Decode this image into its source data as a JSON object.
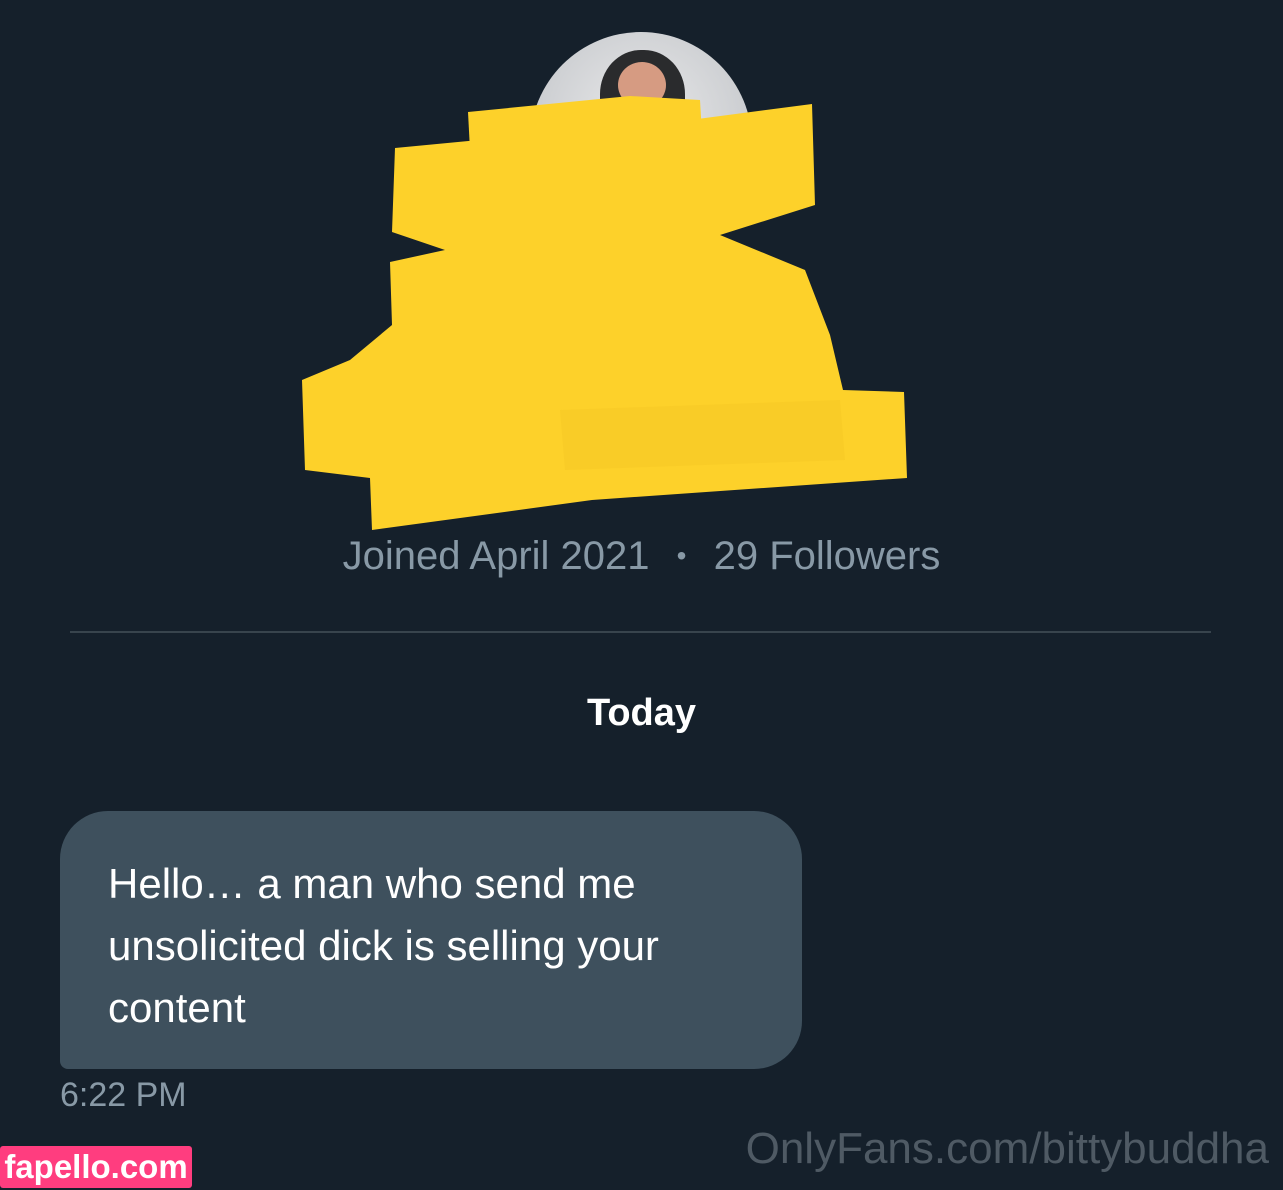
{
  "profile": {
    "joined": "Joined April 2021",
    "separator": "•",
    "followers": "29 Followers"
  },
  "conversation": {
    "day_label": "Today",
    "message": {
      "text": "Hello… a man who send me unsolicited dick is selling your content",
      "time": "6:22 PM"
    }
  },
  "watermarks": {
    "left": "fapello.com",
    "right": "OnlyFans.com/bittybuddha"
  },
  "colors": {
    "background": "#15202b",
    "bubble": "#3e505d",
    "secondary_text": "#8899a6",
    "redaction": "#fdd12a",
    "watermark_badge": "#ff3d7f"
  },
  "icons": {
    "avatar": "profile-avatar",
    "redaction": "yellow-redaction-scribble"
  }
}
